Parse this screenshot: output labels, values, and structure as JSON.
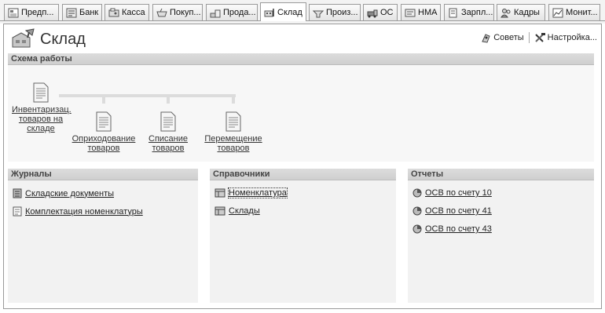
{
  "tabs": [
    {
      "label": "Предп...",
      "icon": "enterprise-icon"
    },
    {
      "label": "Банк",
      "icon": "bank-icon"
    },
    {
      "label": "Касса",
      "icon": "cash-icon"
    },
    {
      "label": "Покуп...",
      "icon": "purchases-icon"
    },
    {
      "label": "Прода...",
      "icon": "sales-icon"
    },
    {
      "label": "Склад",
      "icon": "warehouse-icon",
      "active": true
    },
    {
      "label": "Произ...",
      "icon": "production-icon"
    },
    {
      "label": "ОС",
      "icon": "fixed-assets-icon"
    },
    {
      "label": "НМА",
      "icon": "intangible-assets-icon"
    },
    {
      "label": "Зарпл...",
      "icon": "salary-icon"
    },
    {
      "label": "Кадры",
      "icon": "personnel-icon"
    },
    {
      "label": "Монит...",
      "icon": "monitor-icon"
    }
  ],
  "page": {
    "title": "Склад",
    "tips_label": "Советы",
    "settings_label": "Настройка..."
  },
  "scheme": {
    "title": "Схема работы",
    "nodes": [
      {
        "line1": "Инвентаризац.",
        "line2": "товаров на",
        "line3": "складе"
      },
      {
        "line1": "Оприходование",
        "line2": "товаров"
      },
      {
        "line1": "Списание",
        "line2": "товаров"
      },
      {
        "line1": "Перемещение",
        "line2": "товаров"
      }
    ]
  },
  "journals": {
    "title": "Журналы",
    "items": [
      "Складские документы",
      "Комплектация номенклатуры"
    ]
  },
  "references": {
    "title": "Справочники",
    "items": [
      "Номенклатура",
      "Склады"
    ]
  },
  "reports": {
    "title": "Отчеты",
    "items": [
      "ОСВ по счету 10",
      "ОСВ по счету 41",
      "ОСВ по счету 43"
    ]
  }
}
